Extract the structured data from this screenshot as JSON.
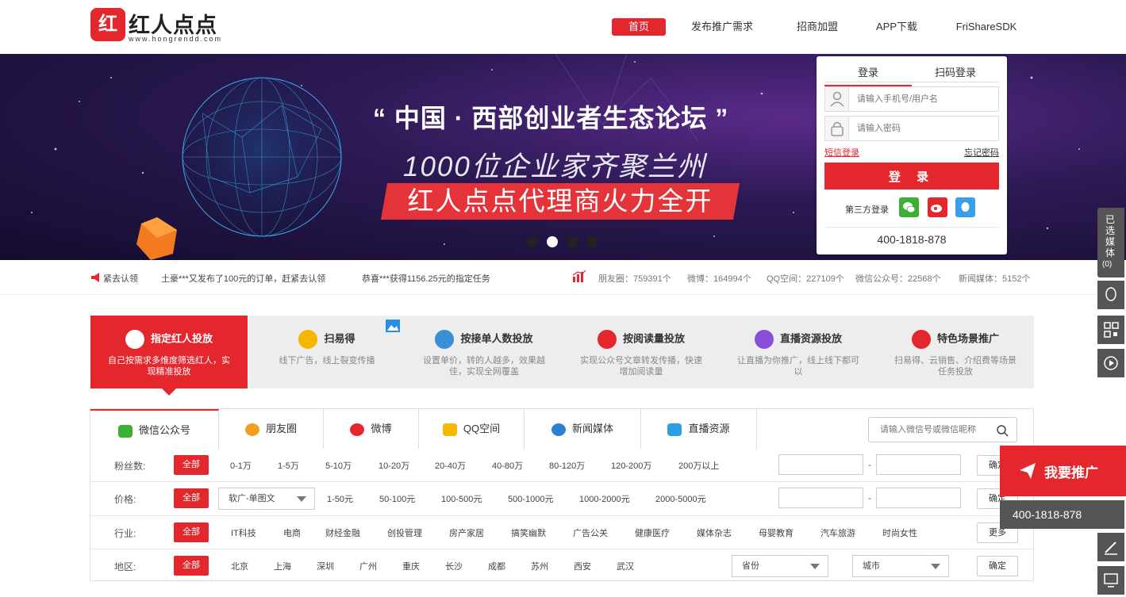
{
  "header": {
    "logo_mark": "红",
    "logo_name": "红人点点",
    "logo_url": "www.hongrendd.com",
    "nav": [
      "首页",
      "发布推广需求",
      "招商加盟",
      "APP下载",
      "FriShareSDK"
    ]
  },
  "banner": {
    "headline": "“ 中国 · 西部创业者生态论坛 ”",
    "subline": "1000位企业家齐聚兰州",
    "tagline": "红人点点代理商火力全开",
    "active_dot": 2
  },
  "login": {
    "tabs": [
      "登录",
      "扫码登录"
    ],
    "username_placeholder": "请输入手机号/用户名",
    "password_placeholder": "请输入密码",
    "sms_login": "短信登录",
    "forgot": "忘记密码",
    "submit": "登 录",
    "third_party_label": "第三方登录",
    "phone": "400-1818-878"
  },
  "ticker": {
    "items": [
      "紧去认领",
      "土豪***又发布了100元的订单，赶紧去认领",
      "恭喜***获得1156.25元的指定任务"
    ],
    "stats": [
      "朋友圈：759391个",
      "微博：164994个",
      "QQ空间：227109个",
      "微信公众号：22568个",
      "新闻媒体：5152个"
    ]
  },
  "categories": [
    {
      "title": "指定红人投放",
      "desc": "自己按需求多维度筛选红人，实现精准投放",
      "color": "#ffffff"
    },
    {
      "title": "扫易得",
      "desc": "线下广告，线上裂变传播",
      "color": "#f5b800"
    },
    {
      "title": "按接单人数投放",
      "desc": "设置单价，转的人越多，效果越佳，实现全网覆盖",
      "color": "#3a8fd8"
    },
    {
      "title": "按阅读量投放",
      "desc": "实现公众号文章转发传播，快速增加阅读量",
      "color": "#e4262d"
    },
    {
      "title": "直播资源投放",
      "desc": "让直播为你推广，线上线下都可以",
      "color": "#8a4fd8"
    },
    {
      "title": "特色场景推广",
      "desc": "扫易得、云销售、介绍费等场景任务投放",
      "color": "#e4262d"
    }
  ],
  "media_tabs": [
    {
      "label": "微信公众号",
      "color": "#3cb034"
    },
    {
      "label": "朋友圈",
      "color": "#f0a020"
    },
    {
      "label": "微博",
      "color": "#e4262d"
    },
    {
      "label": "QQ空间",
      "color": "#f5b800"
    },
    {
      "label": "新闻媒体",
      "color": "#2a7fd0"
    },
    {
      "label": "直播资源",
      "color": "#2aa0e0"
    }
  ],
  "media_search_placeholder": "请输入微信号或微信昵称",
  "filters": {
    "fans": {
      "label": "粉丝数:",
      "all": "全部",
      "options": [
        "0-1万",
        "1-5万",
        "5-10万",
        "10-20万",
        "20-40万",
        "40-80万",
        "80-120万",
        "120-200万",
        "200万以上"
      ],
      "confirm": "确定",
      "dash": "-"
    },
    "price": {
      "label": "价格:",
      "all": "全部",
      "select": "软广-单图文",
      "options": [
        "1-50元",
        "50-100元",
        "100-500元",
        "500-1000元",
        "1000-2000元",
        "2000-5000元"
      ],
      "confirm": "确定",
      "dash": "-"
    },
    "industry": {
      "label": "行业:",
      "all": "全部",
      "options": [
        "IT科技",
        "电商",
        "财经金融",
        "创投管理",
        "房产家居",
        "搞笑幽默",
        "广告公关",
        "健康医疗",
        "媒体杂志",
        "母婴教育",
        "汽车旅游",
        "时尚女性"
      ],
      "more": "更多"
    },
    "region": {
      "label": "地区:",
      "all": "全部",
      "options": [
        "北京",
        "上海",
        "深圳",
        "广州",
        "重庆",
        "长沙",
        "成都",
        "苏州",
        "西安",
        "武汉"
      ],
      "province": "省份",
      "city": "城市",
      "confirm": "确定"
    }
  },
  "sidebar": {
    "selected_media": "已选媒体",
    "selected_count": "(0)",
    "promo": "我要推广",
    "phone": "400-1818-878"
  },
  "colors": {
    "brand": "#e4262d",
    "sidebar": "#555555"
  }
}
